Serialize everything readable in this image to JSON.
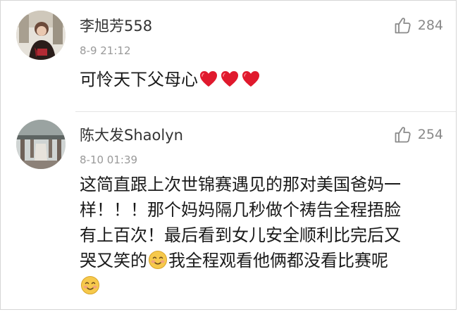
{
  "comments": [
    {
      "username": "李旭芳558",
      "time": "8-9 21:12",
      "likes": "284",
      "text": "可怜天下父母心",
      "trailing_emojis": [
        "red-heart",
        "red-heart",
        "red-heart"
      ]
    },
    {
      "username": "陈大发Shaolyn",
      "time": "8-10 01:39",
      "likes": "254",
      "lines": [
        "这简直跟上次世锦赛遇见的那对美国爸妈一",
        "样！！！那个妈妈隔几秒做个祷告全程捂脸",
        "有上百次！最后看到女儿安全顺利比完后又",
        "哭又笑的",
        "我全程观看他俩都没看比赛呢"
      ],
      "emojis": [
        "smiling-face",
        "smiling-face"
      ]
    }
  ],
  "colors": {
    "username": "#333333",
    "time": "#999999",
    "like_icon": "#888888",
    "heart": "#e0192d",
    "emoji_face": "#f6c94b"
  },
  "icons": {
    "like": "thumbs-up-outline-icon",
    "heart": "red-heart-emoji",
    "smile": "smiling-face-emoji"
  }
}
